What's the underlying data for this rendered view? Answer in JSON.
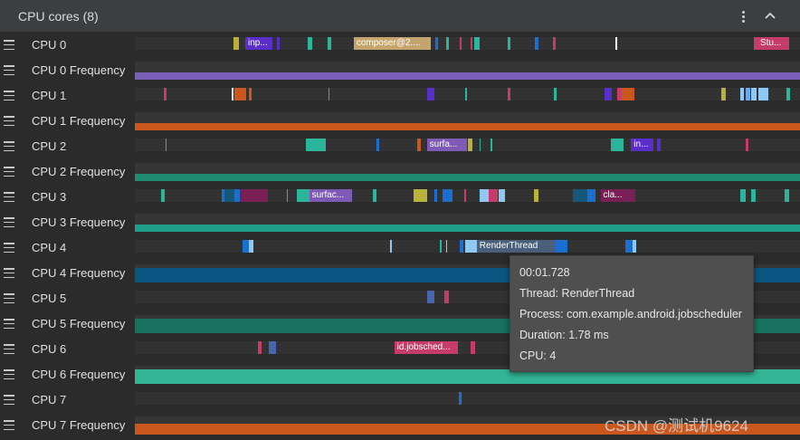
{
  "panel": {
    "title": "CPU cores (8)",
    "menu_icon": "kebab-menu-icon",
    "collapse_icon": "chevron-up-icon"
  },
  "rows": [
    {
      "label": "CPU 0",
      "kind": "cpu",
      "slices": [
        {
          "s": 0.148,
          "e": 0.157,
          "c": "#b8b23a"
        },
        {
          "s": 0.166,
          "e": 0.207,
          "c": "#5a2fc9",
          "t": "inp..."
        },
        {
          "s": 0.213,
          "e": 0.218,
          "c": "#5a2fc9"
        },
        {
          "s": 0.26,
          "e": 0.266,
          "c": "#2bb59c"
        },
        {
          "s": 0.29,
          "e": 0.295,
          "c": "#2bb59c"
        },
        {
          "s": 0.329,
          "e": 0.445,
          "c": "#c5a46e",
          "t": "composer@2...."
        },
        {
          "s": 0.452,
          "e": 0.456,
          "c": "#1b6fd1"
        },
        {
          "s": 0.468,
          "e": 0.472,
          "c": "#2bb59c"
        },
        {
          "s": 0.489,
          "e": 0.491,
          "c": "#c53c6a"
        },
        {
          "s": 0.505,
          "e": 0.508,
          "c": "#c53c6a"
        },
        {
          "s": 0.51,
          "e": 0.519,
          "c": "#2bb59c"
        },
        {
          "s": 0.561,
          "e": 0.565,
          "c": "#2bb59c"
        },
        {
          "s": 0.602,
          "e": 0.607,
          "c": "#1b6fd1"
        },
        {
          "s": 0.628,
          "e": 0.633,
          "c": "#c53c6a"
        },
        {
          "s": 0.722,
          "e": 0.725,
          "c": "#ffffff"
        },
        {
          "s": 0.931,
          "e": 0.936,
          "c": "#c53c6a"
        },
        {
          "s": 0.936,
          "e": 0.984,
          "c": "#c53c6a",
          "t": "Stu..."
        }
      ]
    },
    {
      "label": "CPU 0 Frequency",
      "kind": "freq",
      "color": "#7a5fb8",
      "level": 0.4
    },
    {
      "label": "CPU 1",
      "kind": "cpu",
      "slices": [
        {
          "s": 0.043,
          "e": 0.047,
          "c": "#c53c6a"
        },
        {
          "s": 0.146,
          "e": 0.148,
          "c": "#ffffff"
        },
        {
          "s": 0.15,
          "e": 0.167,
          "c": "#c9571e"
        },
        {
          "s": 0.172,
          "e": 0.176,
          "c": "#c9571e"
        },
        {
          "s": 0.291,
          "e": 0.293,
          "c": "#2bb59c"
        },
        {
          "s": 0.44,
          "e": 0.451,
          "c": "#5a2fc9"
        },
        {
          "s": 0.497,
          "e": 0.5,
          "c": "#2bb59c"
        },
        {
          "s": 0.56,
          "e": 0.564,
          "c": "#c53c6a"
        },
        {
          "s": 0.63,
          "e": 0.634,
          "c": "#2bb59c"
        },
        {
          "s": 0.706,
          "e": 0.717,
          "c": "#5a2fc9"
        },
        {
          "s": 0.725,
          "e": 0.732,
          "c": "#c53c6a"
        },
        {
          "s": 0.732,
          "e": 0.751,
          "c": "#c9571e"
        },
        {
          "s": 0.882,
          "e": 0.889,
          "c": "#b8b23a"
        },
        {
          "s": 0.91,
          "e": 0.916,
          "c": "#8fc8f5"
        },
        {
          "s": 0.918,
          "e": 0.925,
          "c": "#6aa9ef"
        },
        {
          "s": 0.927,
          "e": 0.935,
          "c": "#8fc8f5"
        },
        {
          "s": 0.937,
          "e": 0.952,
          "c": "#8fc8f5"
        },
        {
          "s": 0.98,
          "e": 0.985,
          "c": "#2bb59c"
        }
      ]
    },
    {
      "label": "CPU 1 Frequency",
      "kind": "freq",
      "color": "#c9571e",
      "level": 0.4
    },
    {
      "label": "CPU 2",
      "kind": "cpu",
      "slices": [
        {
          "s": 0.046,
          "e": 0.048,
          "c": "#2bb59c"
        },
        {
          "s": 0.257,
          "e": 0.28,
          "c": "#2bb59c"
        },
        {
          "s": 0.28,
          "e": 0.287,
          "c": "#2bb59c"
        },
        {
          "s": 0.363,
          "e": 0.368,
          "c": "#1b6fd1"
        },
        {
          "s": 0.424,
          "e": 0.43,
          "c": "#c9571e"
        },
        {
          "s": 0.439,
          "e": 0.5,
          "c": "#7e5ab6",
          "t": "surfa..."
        },
        {
          "s": 0.5,
          "e": 0.508,
          "c": "#b8b23a"
        },
        {
          "s": 0.518,
          "e": 0.52,
          "c": "#2bb59c"
        },
        {
          "s": 0.535,
          "e": 0.537,
          "c": "#2bb59c"
        },
        {
          "s": 0.715,
          "e": 0.735,
          "c": "#2bb59c"
        },
        {
          "s": 0.746,
          "e": 0.78,
          "c": "#5a2fc9",
          "t": "in..."
        },
        {
          "s": 0.785,
          "e": 0.79,
          "c": "#5a2fc9"
        },
        {
          "s": 0.918,
          "e": 0.923,
          "c": "#c53c6a"
        }
      ]
    },
    {
      "label": "CPU 2 Frequency",
      "kind": "freq",
      "color": "#1f8c72",
      "level": 0.4
    },
    {
      "label": "CPU 3",
      "kind": "cpu",
      "slices": [
        {
          "s": 0.04,
          "e": 0.045,
          "c": "#2bb59c"
        },
        {
          "s": 0.131,
          "e": 0.135,
          "c": "#1b6fd1"
        },
        {
          "s": 0.135,
          "e": 0.15,
          "c": "#16587a"
        },
        {
          "s": 0.15,
          "e": 0.16,
          "c": "#1b6fd1"
        },
        {
          "s": 0.158,
          "e": 0.176,
          "c": "#7a1f55"
        },
        {
          "s": 0.176,
          "e": 0.2,
          "c": "#7a1f55"
        },
        {
          "s": 0.228,
          "e": 0.23,
          "c": "#2bb59c"
        },
        {
          "s": 0.244,
          "e": 0.262,
          "c": "#2bb59c"
        },
        {
          "s": 0.262,
          "e": 0.327,
          "c": "#7e5ab6",
          "t": "surfac..."
        },
        {
          "s": 0.358,
          "e": 0.363,
          "c": "#2bb59c"
        },
        {
          "s": 0.419,
          "e": 0.44,
          "c": "#b8b23a"
        },
        {
          "s": 0.45,
          "e": 0.455,
          "c": "#1b6fd1"
        },
        {
          "s": 0.463,
          "e": 0.478,
          "c": "#1b6fd1"
        },
        {
          "s": 0.495,
          "e": 0.498,
          "c": "#c53c6a"
        },
        {
          "s": 0.518,
          "e": 0.532,
          "c": "#8fc8f5"
        },
        {
          "s": 0.532,
          "e": 0.545,
          "c": "#c53c6a"
        },
        {
          "s": 0.547,
          "e": 0.557,
          "c": "#8fc8f5"
        },
        {
          "s": 0.6,
          "e": 0.607,
          "c": "#b8b23a"
        },
        {
          "s": 0.658,
          "e": 0.68,
          "c": "#16587a"
        },
        {
          "s": 0.68,
          "e": 0.692,
          "c": "#1b6fd1"
        },
        {
          "s": 0.7,
          "e": 0.752,
          "c": "#7a1f55",
          "t": "cla..."
        },
        {
          "s": 0.91,
          "e": 0.918,
          "c": "#2bb59c"
        },
        {
          "s": 0.926,
          "e": 0.933,
          "c": "#2bb59c"
        },
        {
          "s": 0.977,
          "e": 0.983,
          "c": "#2bb59c"
        }
      ]
    },
    {
      "label": "CPU 3 Frequency",
      "kind": "freq",
      "color": "#1d9d8a",
      "level": 0.4
    },
    {
      "label": "CPU 4",
      "kind": "cpu",
      "slices": [
        {
          "s": 0.162,
          "e": 0.172,
          "c": "#1b6fd1"
        },
        {
          "s": 0.172,
          "e": 0.178,
          "c": "#8fc8f5"
        },
        {
          "s": 0.383,
          "e": 0.386,
          "c": "#8fc8f5"
        },
        {
          "s": 0.459,
          "e": 0.461,
          "c": "#2bb59c"
        },
        {
          "s": 0.468,
          "e": 0.47,
          "c": "#8fc8f5"
        },
        {
          "s": 0.488,
          "e": 0.494,
          "c": "#1b6fd1"
        },
        {
          "s": 0.497,
          "e": 0.514,
          "c": "#8fc8f5"
        },
        {
          "s": 0.514,
          "e": 0.632,
          "c": "#4a5f79",
          "t": "RenderThread"
        },
        {
          "s": 0.632,
          "e": 0.65,
          "c": "#1b6fd1"
        },
        {
          "s": 0.738,
          "e": 0.752,
          "c": "#1b6fd1"
        },
        {
          "s": 0.748,
          "e": 0.754,
          "c": "#8fc8f5"
        }
      ]
    },
    {
      "label": "CPU 4 Frequency",
      "kind": "freq",
      "color": "#0b5582",
      "level": 0.8
    },
    {
      "label": "CPU 5",
      "kind": "cpu",
      "slices": [
        {
          "s": 0.439,
          "e": 0.45,
          "c": "#4866b0"
        },
        {
          "s": 0.465,
          "e": 0.472,
          "c": "#c53c6a"
        }
      ]
    },
    {
      "label": "CPU 5 Frequency",
      "kind": "freq",
      "color": "#17715e",
      "level": 0.8
    },
    {
      "label": "CPU 6",
      "kind": "cpu",
      "slices": [
        {
          "s": 0.185,
          "e": 0.19,
          "c": "#c53c6a"
        },
        {
          "s": 0.202,
          "e": 0.212,
          "c": "#4866b0"
        },
        {
          "s": 0.39,
          "e": 0.486,
          "c": "#c53c6a",
          "t": "id.jobsched..."
        },
        {
          "s": 0.505,
          "e": 0.511,
          "c": "#c53c6a"
        }
      ]
    },
    {
      "label": "CPU 6 Frequency",
      "kind": "freq",
      "color": "#33b595",
      "level": 0.8
    },
    {
      "label": "CPU 7",
      "kind": "cpu",
      "slices": [
        {
          "s": 0.487,
          "e": 0.491,
          "c": "#1b6fd1"
        }
      ]
    },
    {
      "label": "CPU 7 Frequency",
      "kind": "freq",
      "color": "#c9571e",
      "level": 0.6
    }
  ],
  "tooltip": {
    "timestamp": "00:01.728",
    "thread": "Thread: RenderThread",
    "process": "Process: com.example.android.jobscheduler",
    "duration": "Duration: 1.78 ms",
    "cpu": "CPU: 4"
  },
  "watermark": "CSDN @测试机9624",
  "handle_icon": "drag-handle-icon"
}
